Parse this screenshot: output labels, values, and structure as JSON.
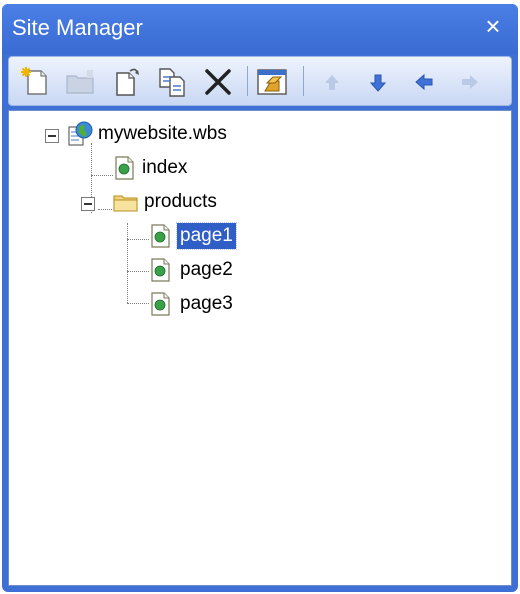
{
  "panel": {
    "title": "Site Manager",
    "close_glyph": "×"
  },
  "toolbar": {
    "buttons": [
      {
        "name": "new-page-icon"
      },
      {
        "name": "new-folder-icon"
      },
      {
        "name": "open-page-icon"
      },
      {
        "name": "copy-page-icon"
      },
      {
        "name": "delete-icon"
      },
      {
        "name": "properties-icon"
      },
      {
        "name": "move-up-icon"
      },
      {
        "name": "move-down-icon"
      },
      {
        "name": "move-left-icon"
      },
      {
        "name": "move-right-icon"
      }
    ]
  },
  "tree": {
    "root": {
      "label": "mywebsite.wbs",
      "icon": "website-icon"
    },
    "nodes": [
      {
        "label": "index",
        "icon": "page-icon"
      },
      {
        "label": "products",
        "icon": "folder-icon"
      },
      {
        "label": "page1",
        "icon": "page-icon",
        "selected": true
      },
      {
        "label": "page2",
        "icon": "page-icon"
      },
      {
        "label": "page3",
        "icon": "page-icon"
      }
    ]
  },
  "colors": {
    "title_bar": "#3a6bd2",
    "selection": "#2f5fc6"
  }
}
